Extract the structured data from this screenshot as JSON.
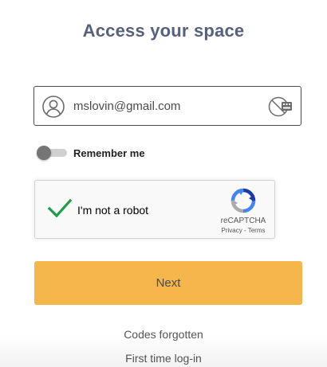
{
  "page": {
    "title": "Access your space"
  },
  "login": {
    "email_value": "mslovin@gmail.com",
    "user_icon": "user-circle-icon",
    "key_icon": "virtual-keyboard-icon"
  },
  "remember": {
    "label": "Remember me",
    "enabled": false
  },
  "captcha": {
    "label": "I'm not a robot",
    "checked": true,
    "brand": "reCAPTCHA",
    "privacy": "Privacy",
    "separator": " - ",
    "terms": "Terms"
  },
  "actions": {
    "next_label": "Next",
    "codes_forgotten": "Codes forgotten",
    "first_time": "First time log-in"
  },
  "colors": {
    "title": "#56607f",
    "button": "#f5b64b",
    "check": "#1e9e4a"
  }
}
